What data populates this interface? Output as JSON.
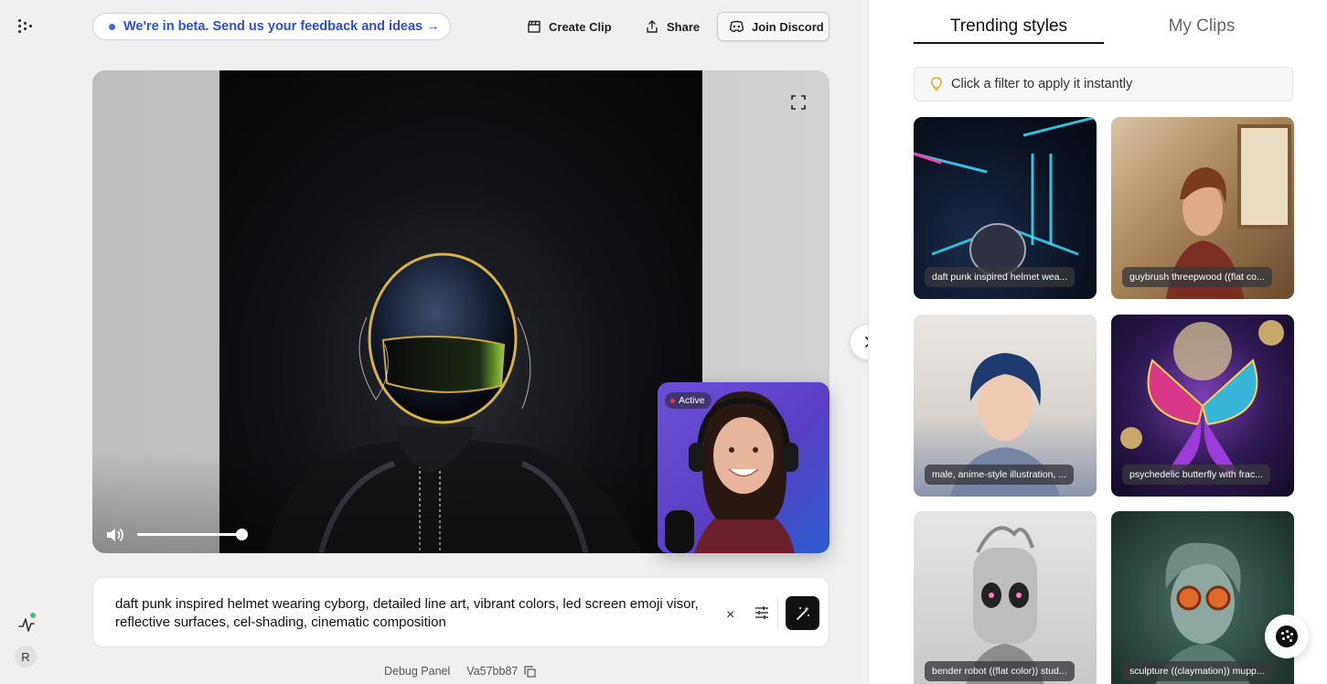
{
  "header": {
    "beta_banner": "We're in beta. Send us your feedback and ideas →",
    "create_clip": "Create Clip",
    "share": "Share",
    "join_discord": "Join Discord"
  },
  "rail": {
    "avatar_initial": "R"
  },
  "webcam": {
    "status": "Active"
  },
  "video": {
    "volume_level": 0.9
  },
  "prompt": {
    "text": "daft punk inspired helmet wearing cyborg, detailed line art, vibrant colors, led screen emoji visor, reflective surfaces, cel-shading, cinematic composition",
    "clear_label": "×"
  },
  "footer": {
    "debug_panel": "Debug Panel",
    "version": "Va57bb87"
  },
  "panel": {
    "tabs": [
      {
        "label": "Trending styles",
        "active": true
      },
      {
        "label": "My Clips",
        "active": false
      }
    ],
    "hint": "Click a filter to apply it instantly",
    "styles": [
      {
        "caption": "daft punk inspired helmet wea..."
      },
      {
        "caption": "guybrush threepwood ((flat co..."
      },
      {
        "caption": "male, anime-style illustration, ..."
      },
      {
        "caption": "psychedelic butterfly with frac..."
      },
      {
        "caption": "bender robot ((flat color)) stud..."
      },
      {
        "caption": "sculpture ((claymation)) mupp..."
      }
    ]
  },
  "colors": {
    "accent_blue": "#2b4fcf",
    "status_green": "#3ec46d",
    "live_red": "#e33"
  }
}
